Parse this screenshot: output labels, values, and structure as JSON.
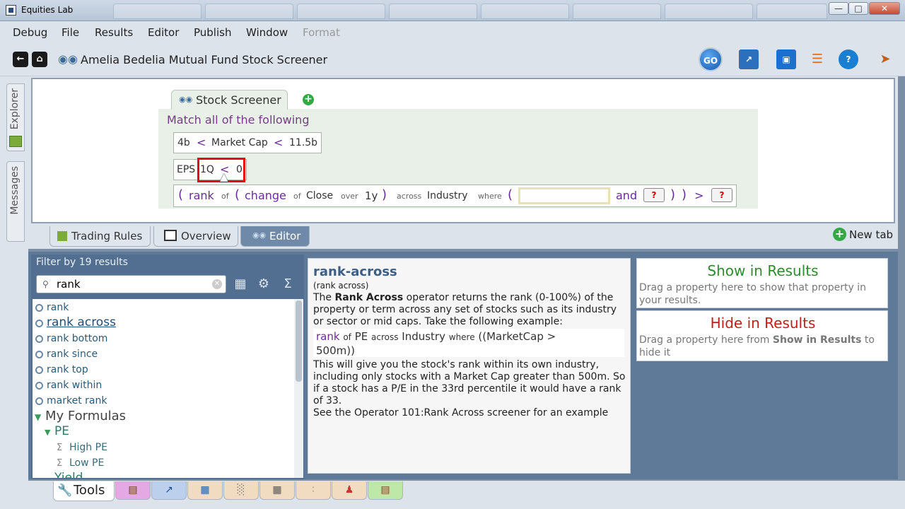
{
  "window": {
    "title": "Equities Lab"
  },
  "menu": [
    "Debug",
    "File",
    "Results",
    "Editor",
    "Publish",
    "Window",
    "Format"
  ],
  "toolbar": {
    "doc_title": "Amelia Bedelia Mutual Fund Stock Screener",
    "go_label": "GO"
  },
  "side_tabs": {
    "explorer": "Explorer",
    "messages": "Messages"
  },
  "editor": {
    "tab_label": "Stock Screener",
    "match_text": "Match all of the following",
    "rule1": {
      "left": "4b",
      "op1": "<",
      "property": "Market Cap",
      "op2": "<",
      "right": "11.5b"
    },
    "rule2": {
      "property": "EPS",
      "period": "1Q",
      "op": "<",
      "value": "0"
    },
    "rule3": {
      "open1": "(",
      "rank": "rank",
      "of1": "of",
      "open2": "(",
      "change": "change",
      "of2": "of",
      "close": "Close",
      "over": "over",
      "period": "1y",
      "close2": ")",
      "across": "across",
      "industry": "Industry",
      "where": "where",
      "open3": "(",
      "input_value": "",
      "and": "and",
      "q": "?",
      "close3": ")",
      "close4": ")",
      "gt": ">"
    }
  },
  "bottom_tabs": {
    "trading_rules": "Trading Rules",
    "overview": "Overview",
    "editor": "Editor",
    "new_tab": "New tab"
  },
  "filter": {
    "label": "Filter by 19 results",
    "search_value": "rank",
    "items": [
      "rank",
      "rank across",
      "rank bottom",
      "rank since",
      "rank top",
      "rank within",
      "market rank"
    ],
    "my_formulas": "My Formulas",
    "folder_pe": "PE",
    "formulas": [
      "High PE",
      "Low PE"
    ],
    "folder_yield": "Yield"
  },
  "help": {
    "title": "rank-across",
    "subtitle": "(rank across)",
    "body_pre": "The ",
    "body_bold": "Rank Across",
    "body_post": " operator returns the rank (0-100%) of the property or term across any set of stocks such as its industry or sector or mid caps. Take the following example:",
    "example": {
      "rank": "rank",
      "of": "of",
      "pe": "PE",
      "across": "across",
      "industry": "Industry",
      "where": "where",
      "cond": "((MarketCap >",
      "cond2": "500m))"
    },
    "body2": "This will give you the stock's rank within its own industry, including only stocks with a Market Cap greater than 500m. So if a stock has a P/E in the 33rd percentile it would have a rank of 33.",
    "body3": "See the Operator 101:Rank Across screener for an example"
  },
  "results_panel": {
    "show_title": "Show in Results",
    "show_desc": "Drag a property here to show that property in your results.",
    "hide_title": "Hide in Results",
    "hide_desc_pre": "Drag a property here from ",
    "hide_desc_bold": "Show in Results",
    "hide_desc_post": " to hide it"
  },
  "tools_tab": "Tools",
  "colors": {
    "accent": "#6b2b9a",
    "show": "#2e8b2e",
    "hide": "#c0201a",
    "highlight": "#e01010"
  }
}
